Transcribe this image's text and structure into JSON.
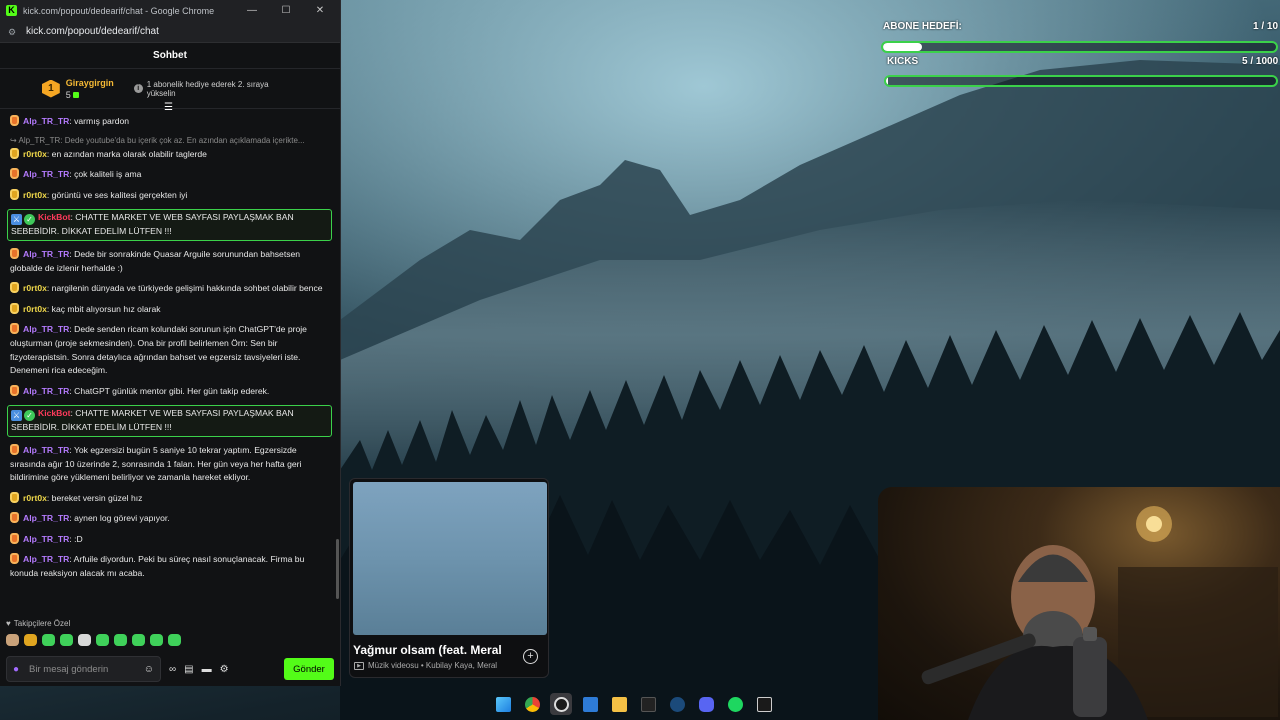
{
  "window": {
    "title": "kick.com/popout/dedearif/chat - Google Chrome",
    "url": "kick.com/popout/dedearif/chat",
    "logo": "K"
  },
  "chat": {
    "header": "Sohbet",
    "top_gifter": {
      "rank": "1",
      "name": "Giraygirgin",
      "count": "5",
      "message": "1 abonelik hediye ederek 2. sıraya yükselin"
    },
    "messages": [
      {
        "user": "Alp_TR_TR",
        "type": "alp",
        "text": "varmış pardon"
      },
      {
        "reply": "↪ Alp_TR_TR: Dede youtube'da bu içerik çok az. En azından açıklamada içerikte...",
        "user": "r0rt0x",
        "type": "r0r",
        "text": "en azından marka olarak olabilir taglerde"
      },
      {
        "user": "Alp_TR_TR",
        "type": "alp",
        "text": "çok kaliteli iş ama"
      },
      {
        "user": "r0rt0x",
        "type": "r0r",
        "text": "görüntü ve ses kalitesi gerçekten iyi"
      },
      {
        "user": "KickBot",
        "type": "bot",
        "text": "CHATTE MARKET VE WEB SAYFASI PAYLAŞMAK BAN SEBEBİDİR. DİKKAT EDELİM LÜTFEN !!!"
      },
      {
        "user": "Alp_TR_TR",
        "type": "alp",
        "text": "Dede bir sonrakinde Quasar Arguile sorunundan bahsetsen globalde de izlenir herhalde :)"
      },
      {
        "user": "r0rt0x",
        "type": "r0r",
        "text": "nargilenin dünyada ve türkiyede gelişimi hakkında sohbet olabilir bence"
      },
      {
        "user": "r0rt0x",
        "type": "r0r",
        "text": "kaç mbit alıyorsun hız olarak"
      },
      {
        "user": "Alp_TR_TR",
        "type": "alp",
        "text": "Dede senden ricam kolundaki sorunun için ChatGPT'de proje oluşturman (proje sekmesinden). Ona bir profil belirlemen Örn: Sen bir fizyoterapistsin. Sonra detaylıca ağrından bahset ve egzersiz tavsiyeleri iste. Denemeni rica edeceğim."
      },
      {
        "user": "Alp_TR_TR",
        "type": "alp",
        "text": "ChatGPT günlük mentor gibi. Her gün takip ederek."
      },
      {
        "user": "KickBot",
        "type": "bot",
        "text": "CHATTE MARKET VE WEB SAYFASI PAYLAŞMAK BAN SEBEBİDİR. DİKKAT EDELİM LÜTFEN !!!"
      },
      {
        "user": "Alp_TR_TR",
        "type": "alp",
        "text": "Yok egzersizi bugün 5 saniye 10 tekrar yaptım. Egzersizde sırasında ağır 10 üzerinde 2, sonrasında 1 falan. Her gün veya her hafta geri bildirimine göre yüklemeni belirliyor ve zamanla hareket ekliyor."
      },
      {
        "user": "r0rt0x",
        "type": "r0r",
        "text": "bereket versin güzel hız"
      },
      {
        "user": "Alp_TR_TR",
        "type": "alp",
        "text": "aynen log görevi yapıyor."
      },
      {
        "user": "Alp_TR_TR",
        "type": "alp",
        "text": ":D"
      },
      {
        "user": "Alp_TR_TR",
        "type": "alp",
        "text": "Arfuile diyordun. Peki bu süreç nasıl sonuçlanacak. Firma bu konuda reaksiyon alacak mı acaba."
      }
    ],
    "emote_section": "Takipçilere Özel",
    "input_placeholder": "Bir mesaj gönderin",
    "send_label": "Gönder"
  },
  "goals": {
    "sub_label": "ABONE HEDEFİ:",
    "sub_value": "1 / 10",
    "sub_progress": 0.1,
    "kicks_label": "KICKS",
    "kicks_value": "5 / 1000",
    "kicks_progress": 0.005
  },
  "video": {
    "title": "Yağmur olsam (feat. Meral",
    "meta": "Müzik videosu • Kubilay Kaya, Meral"
  },
  "taskbar_icons": [
    "windows-icon",
    "chrome-icon",
    "obs-icon",
    "store-icon",
    "folder-icon",
    "epic-alt-icon",
    "steam-icon",
    "discord-icon",
    "spotify-icon",
    "epic-games-icon"
  ],
  "colors": {
    "kick_green": "#53fc18",
    "alp_user": "#b57bff",
    "r0r_user": "#f0d84a",
    "bot_user": "#ff3b5c"
  }
}
